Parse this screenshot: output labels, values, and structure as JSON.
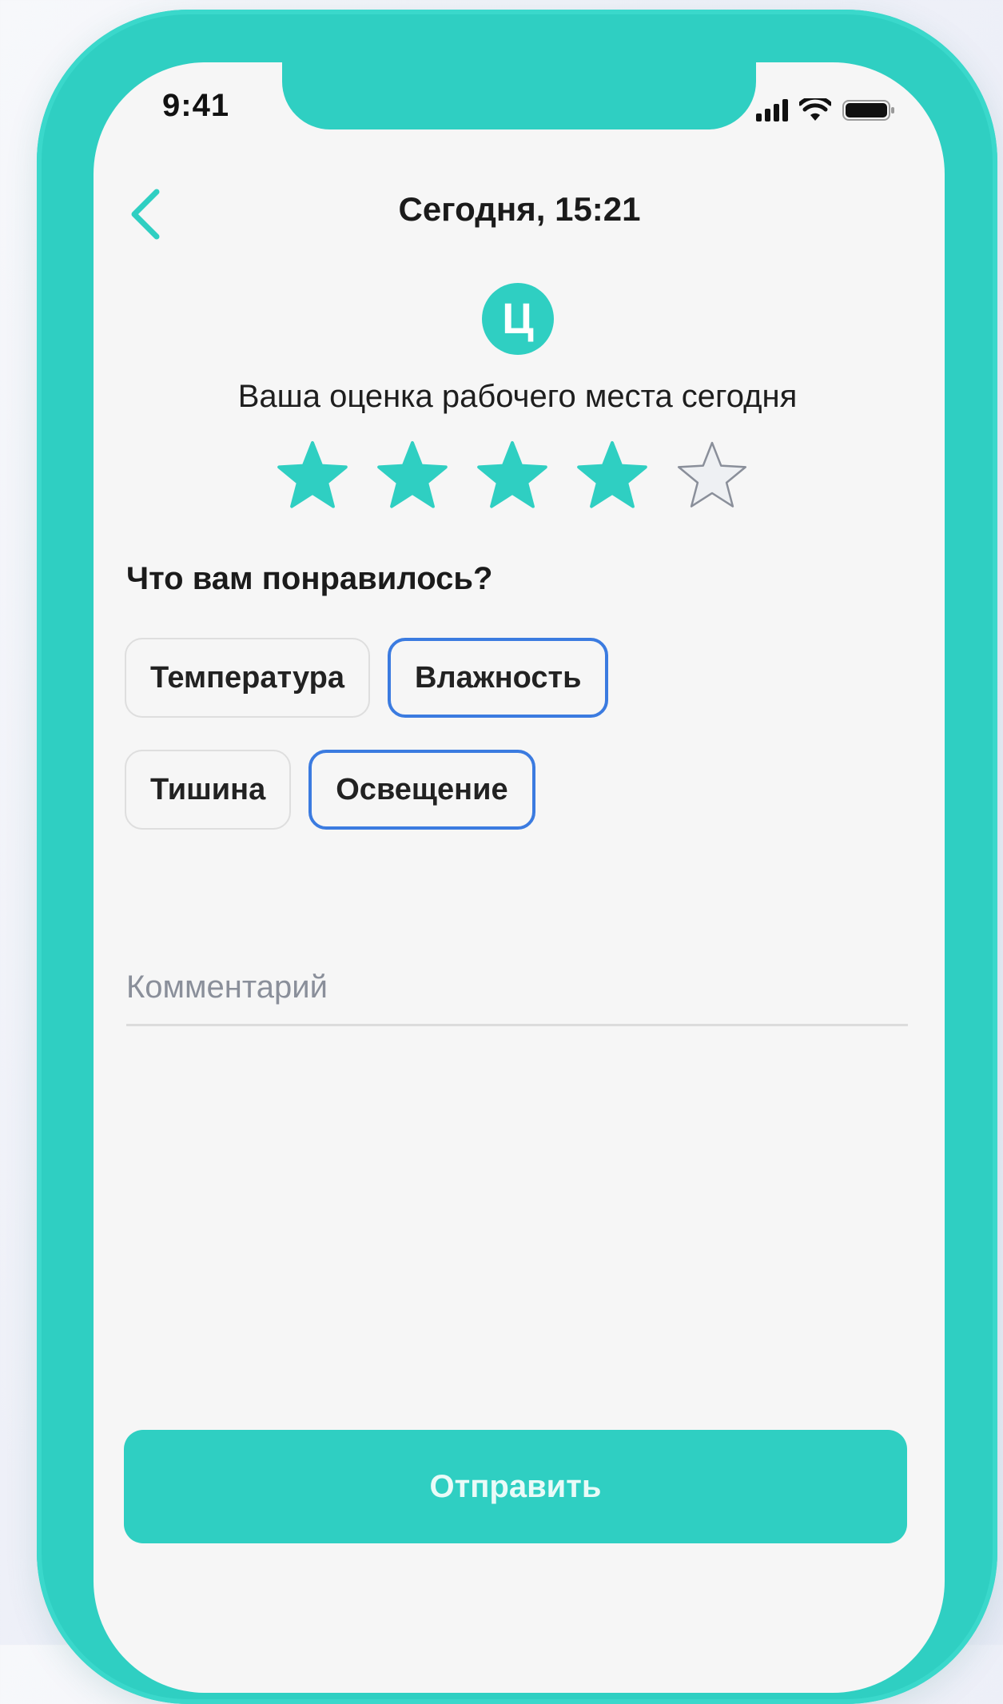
{
  "status_bar": {
    "time": "9:41",
    "icons": [
      "cellular-signal-icon",
      "wifi-icon",
      "battery-icon"
    ]
  },
  "header": {
    "back_icon": "chevron-left-icon",
    "title": "Сегодня, 15:21"
  },
  "logo": {
    "letter": "Ц"
  },
  "rating": {
    "question": "Ваша оценка рабочего места сегодня",
    "value": 4,
    "max": 5
  },
  "liked": {
    "title": "Что вам понравилось?",
    "options": [
      {
        "label": "Температура",
        "selected": false
      },
      {
        "label": "Влажность",
        "selected": true
      },
      {
        "label": "Тишина",
        "selected": false
      },
      {
        "label": "Освещение",
        "selected": true
      }
    ]
  },
  "comment": {
    "placeholder": "Комментарий",
    "value": ""
  },
  "submit": {
    "label": "Отправить"
  },
  "colors": {
    "accent": "#2fcfc2",
    "selected_border": "#3b7be0",
    "star_empty_stroke": "#8a8f9a",
    "star_empty_fill": "#eef0f3"
  }
}
